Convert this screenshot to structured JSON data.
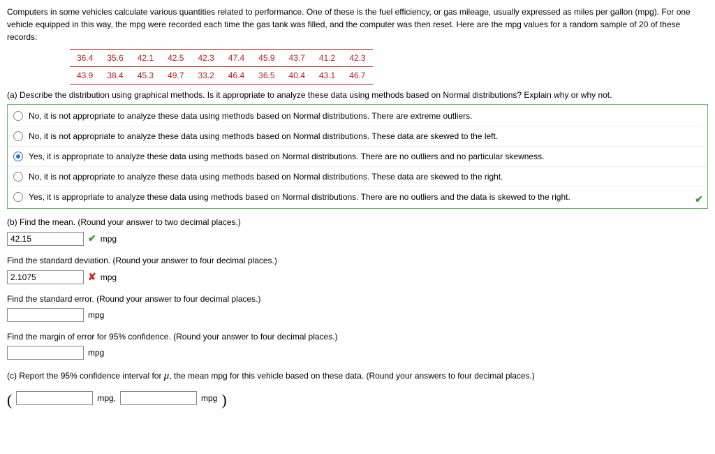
{
  "intro": "Computers in some vehicles calculate various quantities related to performance. One of these is the fuel efficiency, or gas mileage, usually expressed as miles per gallon (mpg). For one vehicle equipped in this way, the mpg were recorded each time the gas tank was filled, and the computer was then reset. Here are the mpg values for a random sample of 20 of these records:",
  "data_rows": [
    [
      "36.4",
      "35.6",
      "42.1",
      "42.5",
      "42.3",
      "47.4",
      "45.9",
      "43.7",
      "41.2",
      "42.3"
    ],
    [
      "43.9",
      "38.4",
      "45.3",
      "49.7",
      "33.2",
      "46.4",
      "36.5",
      "40.4",
      "43.1",
      "46.7"
    ]
  ],
  "part_a_prompt": "(a) Describe the distribution using graphical methods. Is it appropriate to analyze these data using methods based on Normal distributions? Explain why or why not.",
  "choices": [
    {
      "selected": false,
      "text": "No, it is not appropriate to analyze these data using methods based on Normal distributions. There are extreme outliers."
    },
    {
      "selected": false,
      "text": "No, it is not appropriate to analyze these data using methods based on Normal distributions. These data are skewed to the left."
    },
    {
      "selected": true,
      "text": "Yes, it is appropriate to analyze these data using methods based on Normal distributions. There are no outliers and no particular skewness."
    },
    {
      "selected": false,
      "text": "No, it is not appropriate to analyze these data using methods based on Normal distributions. These data are skewed to the right."
    },
    {
      "selected": false,
      "text": "Yes, it is appropriate to analyze these data using methods based on Normal distributions. There are no outliers and the data is skewed to the right."
    }
  ],
  "part_b_mean_prompt": "(b) Find the mean. (Round your answer to two decimal places.)",
  "mean_value": "42.15",
  "unit_mpg": "mpg",
  "std_dev_prompt": "Find the standard deviation. (Round your answer to four decimal places.)",
  "std_dev_value": "2.1075",
  "std_err_prompt": "Find the standard error. (Round your answer to four decimal places.)",
  "std_err_value": "",
  "moe_prompt": "Find the margin of error for 95% confidence. (Round your answer to four decimal places.)",
  "moe_value": "",
  "part_c_prompt_prefix": "(c) Report the 95% confidence interval for ",
  "part_c_prompt_suffix": ", the mean mpg for this vehicle based on these data. (Round your answers to four decimal places.)",
  "ci_lower": "",
  "ci_upper": "",
  "mpg_comma": "mpg,",
  "mu_symbol": "μ",
  "paren_open": "(",
  "paren_close": ")",
  "check_glyph": "✔",
  "cross_glyph": "✘"
}
